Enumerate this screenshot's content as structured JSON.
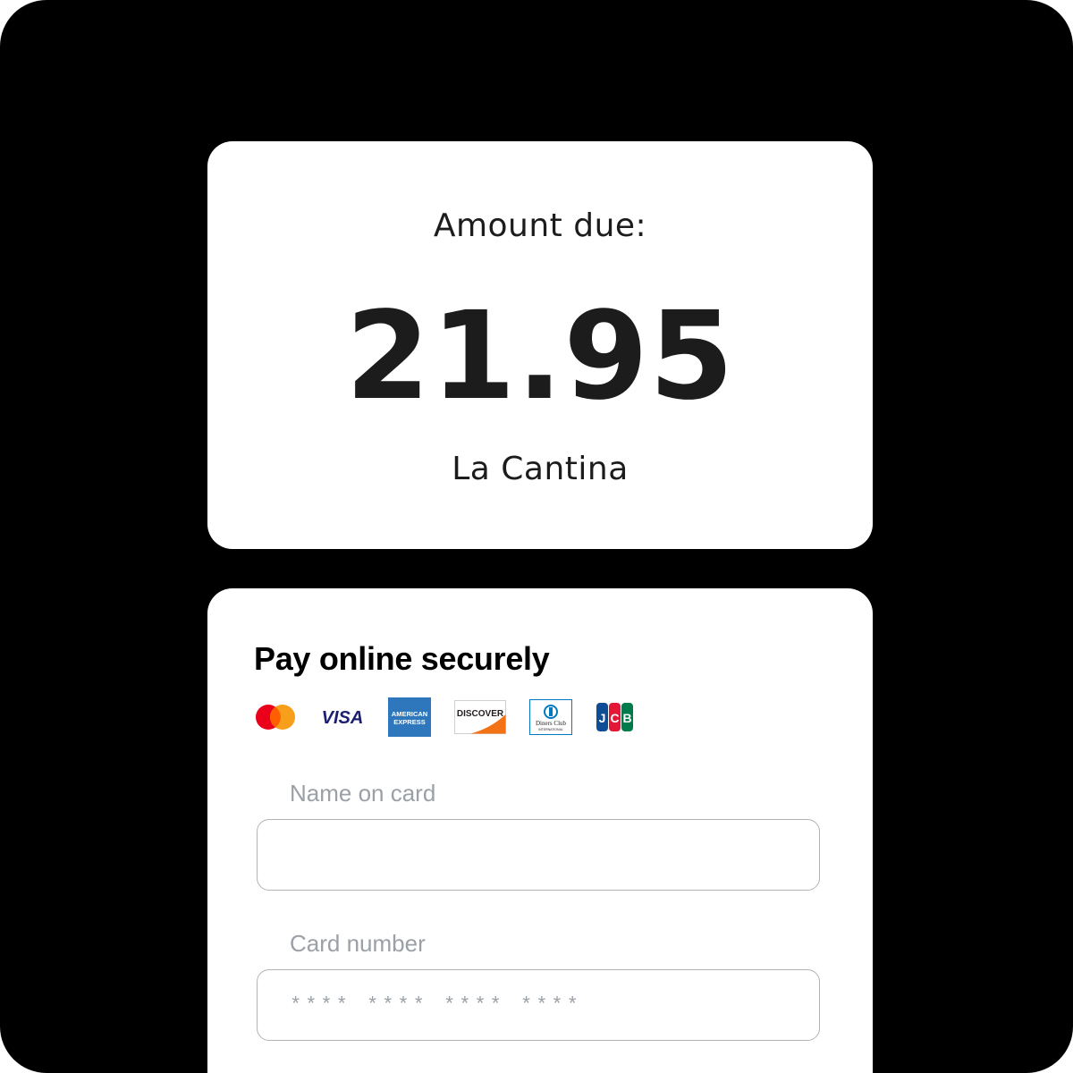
{
  "amount_card": {
    "label": "Amount due:",
    "amount": "21.95",
    "merchant": "La Cantina"
  },
  "payment": {
    "title": "Pay online securely",
    "brands": [
      {
        "icon": "mastercard-icon",
        "colors": [
          "#eb001b",
          "#f79e1b"
        ]
      },
      {
        "icon": "visa-icon",
        "text": "VISA",
        "color": "#1a1f71"
      },
      {
        "icon": "american-express-icon",
        "text": [
          "AMERICAN",
          "EXPRESS"
        ],
        "color": "#2e77bc"
      },
      {
        "icon": "discover-icon",
        "text": "DISCOVER",
        "color": "#f47216"
      },
      {
        "icon": "diners-club-icon",
        "text": [
          "Diners Club",
          "INTERNATIONAL"
        ],
        "color": "#0079be"
      },
      {
        "icon": "jcb-icon",
        "text": "JCB",
        "colors": [
          "#0e4c96",
          "#e21836",
          "#007b49"
        ]
      }
    ],
    "name_field": {
      "label": "Name on card",
      "value": "",
      "placeholder": ""
    },
    "card_field": {
      "label": "Card number",
      "value": "",
      "placeholder": "**** **** **** ****"
    }
  }
}
